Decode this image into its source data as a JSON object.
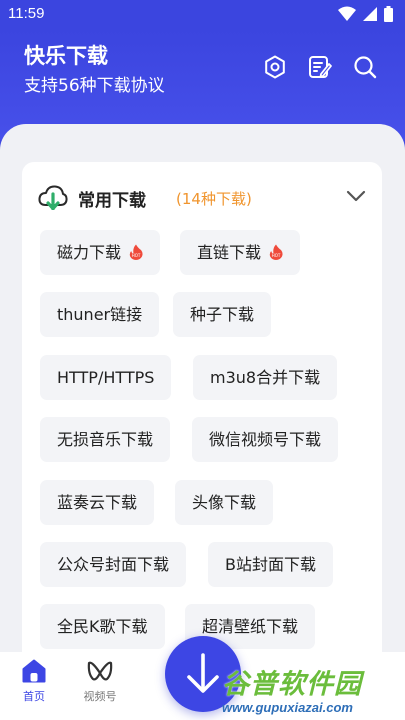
{
  "status": {
    "time": "11:59"
  },
  "header": {
    "title": "快乐下载",
    "subtitle": "支持56种下载协议"
  },
  "section": {
    "title": "常用下载",
    "count": "(14种下载)"
  },
  "chips": [
    {
      "label": "磁力下载",
      "hot": true
    },
    {
      "label": "直链下载",
      "hot": true
    },
    {
      "label": "thuner链接"
    },
    {
      "label": "种子下载"
    },
    {
      "label": "HTTP/HTTPS"
    },
    {
      "label": "m3u8合并下载"
    },
    {
      "label": "无损音乐下载"
    },
    {
      "label": "微信视频号下载"
    },
    {
      "label": "蓝奏云下载"
    },
    {
      "label": "头像下载"
    },
    {
      "label": "公众号封面下载"
    },
    {
      "label": "B站封面下载"
    },
    {
      "label": "全民K歌下载"
    },
    {
      "label": "超清壁纸下载"
    }
  ],
  "tabs": [
    {
      "label": "首页"
    },
    {
      "label": "视频号"
    }
  ],
  "watermark": {
    "main": "谷普软件园",
    "url": "www.gupuxiazai.com"
  },
  "colors": {
    "brand": "#3f48e0",
    "accent_orange": "#f0952e",
    "hot_red": "#ef4b3c"
  }
}
